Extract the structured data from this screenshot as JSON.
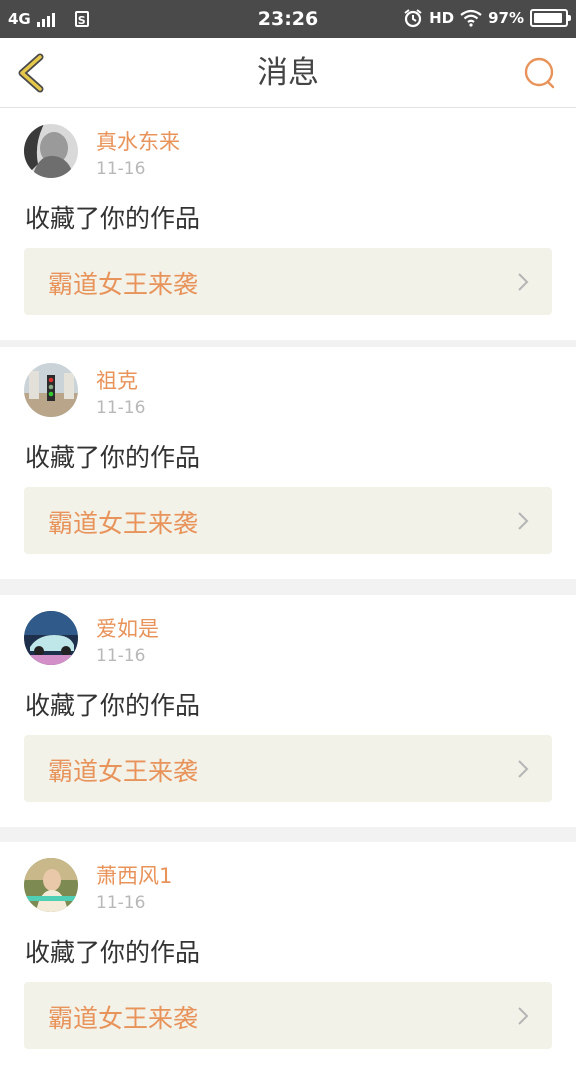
{
  "status_bar": {
    "network": "4G",
    "sim_label": "S",
    "time": "23:26",
    "hd_label": "HD",
    "battery_text": "97%",
    "battery_level": 0.97,
    "icons": [
      "signal-icon",
      "sim-icon",
      "alarm-icon",
      "wifi-icon",
      "battery-icon"
    ]
  },
  "header": {
    "title": "消息",
    "back_icon": "chevron-left-icon",
    "search_icon": "search-icon",
    "accent_color": "#e8935a",
    "back_icon_color": "#e6c94b"
  },
  "messages": [
    {
      "user": "真水东来",
      "date": "11-16",
      "action": "收藏了你的作品",
      "work_title": "霸道女王来袭"
    },
    {
      "user": "祖克",
      "date": "11-16",
      "action": "收藏了你的作品",
      "work_title": "霸道女王来袭"
    },
    {
      "user": "爱如是",
      "date": "11-16",
      "action": "收藏了你的作品",
      "work_title": "霸道女王来袭"
    },
    {
      "user": "萧西风1",
      "date": "11-16",
      "action": "收藏了你的作品",
      "work_title": "霸道女王来袭"
    }
  ]
}
